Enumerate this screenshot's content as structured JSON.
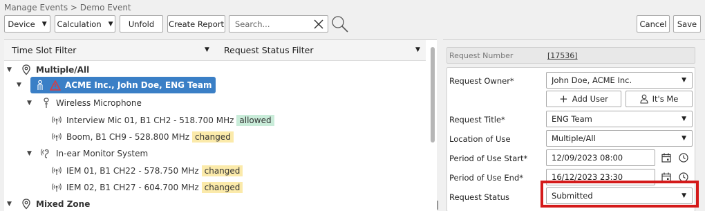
{
  "breadcrumb": "Manage Events > Demo Event",
  "toolbar": {
    "device_label": "Device",
    "calculation_label": "Calculation",
    "unfold_label": "Unfold",
    "create_report_label": "Create Report",
    "search_placeholder": "Search...",
    "cancel_label": "Cancel",
    "save_label": "Save"
  },
  "filters": {
    "time_slot": "Time Slot Filter",
    "request_status": "Request Status Filter"
  },
  "tree": {
    "multiple_all": "Multiple/All",
    "acme": "ACME Inc., John Doe, ENG Team",
    "wireless_mic": "Wireless Microphone",
    "interview_mic": "Interview Mic 01, B1 CH2 - 518.700 MHz",
    "interview_status": "allowed",
    "boom": "Boom, B1 CH9 - 528.800 MHz",
    "boom_status": "changed",
    "iem_system": "In-ear Monitor System",
    "iem01": "IEM 01, B1 CH22 - 578.750 MHz",
    "iem01_status": "changed",
    "iem02": "IEM 02, B1 CH27 - 604.700 MHz",
    "iem02_status": "changed",
    "mixed_zone": "Mixed Zone"
  },
  "form": {
    "request_number_label": "Request Number",
    "request_number_value": "[17536]",
    "request_owner_label": "Request Owner*",
    "request_owner_value": "John Doe, ACME Inc.",
    "add_user_label": "Add User",
    "its_me_label": "It's Me",
    "request_title_label": "Request Title*",
    "request_title_value": "ENG Team",
    "location_label": "Location of Use",
    "location_value": "Multiple/All",
    "period_start_label": "Period of Use Start*",
    "period_start_value": "12/09/2023 08:00",
    "period_end_label": "Period of Use End*",
    "period_end_value": "16/12/2023 23:30",
    "request_status_label": "Request Status",
    "request_status_value": "Submitted"
  },
  "colors": {
    "selected_row": "#3a7fc6",
    "allowed_badge": "#c9ecd9",
    "changed_badge": "#fbeaaa",
    "highlight": "#d41a1a",
    "warning": "#e0393e"
  },
  "icons": {
    "pin": "map-pin-icon",
    "person": "person-icon",
    "warning": "warning-icon",
    "microphone": "microphone-icon",
    "wireless": "wireless-signal-icon",
    "ear": "ear-icon",
    "calendar": "calendar-icon",
    "clock": "clock-icon",
    "plus": "plus-icon",
    "search": "search-icon",
    "close": "close-icon"
  }
}
